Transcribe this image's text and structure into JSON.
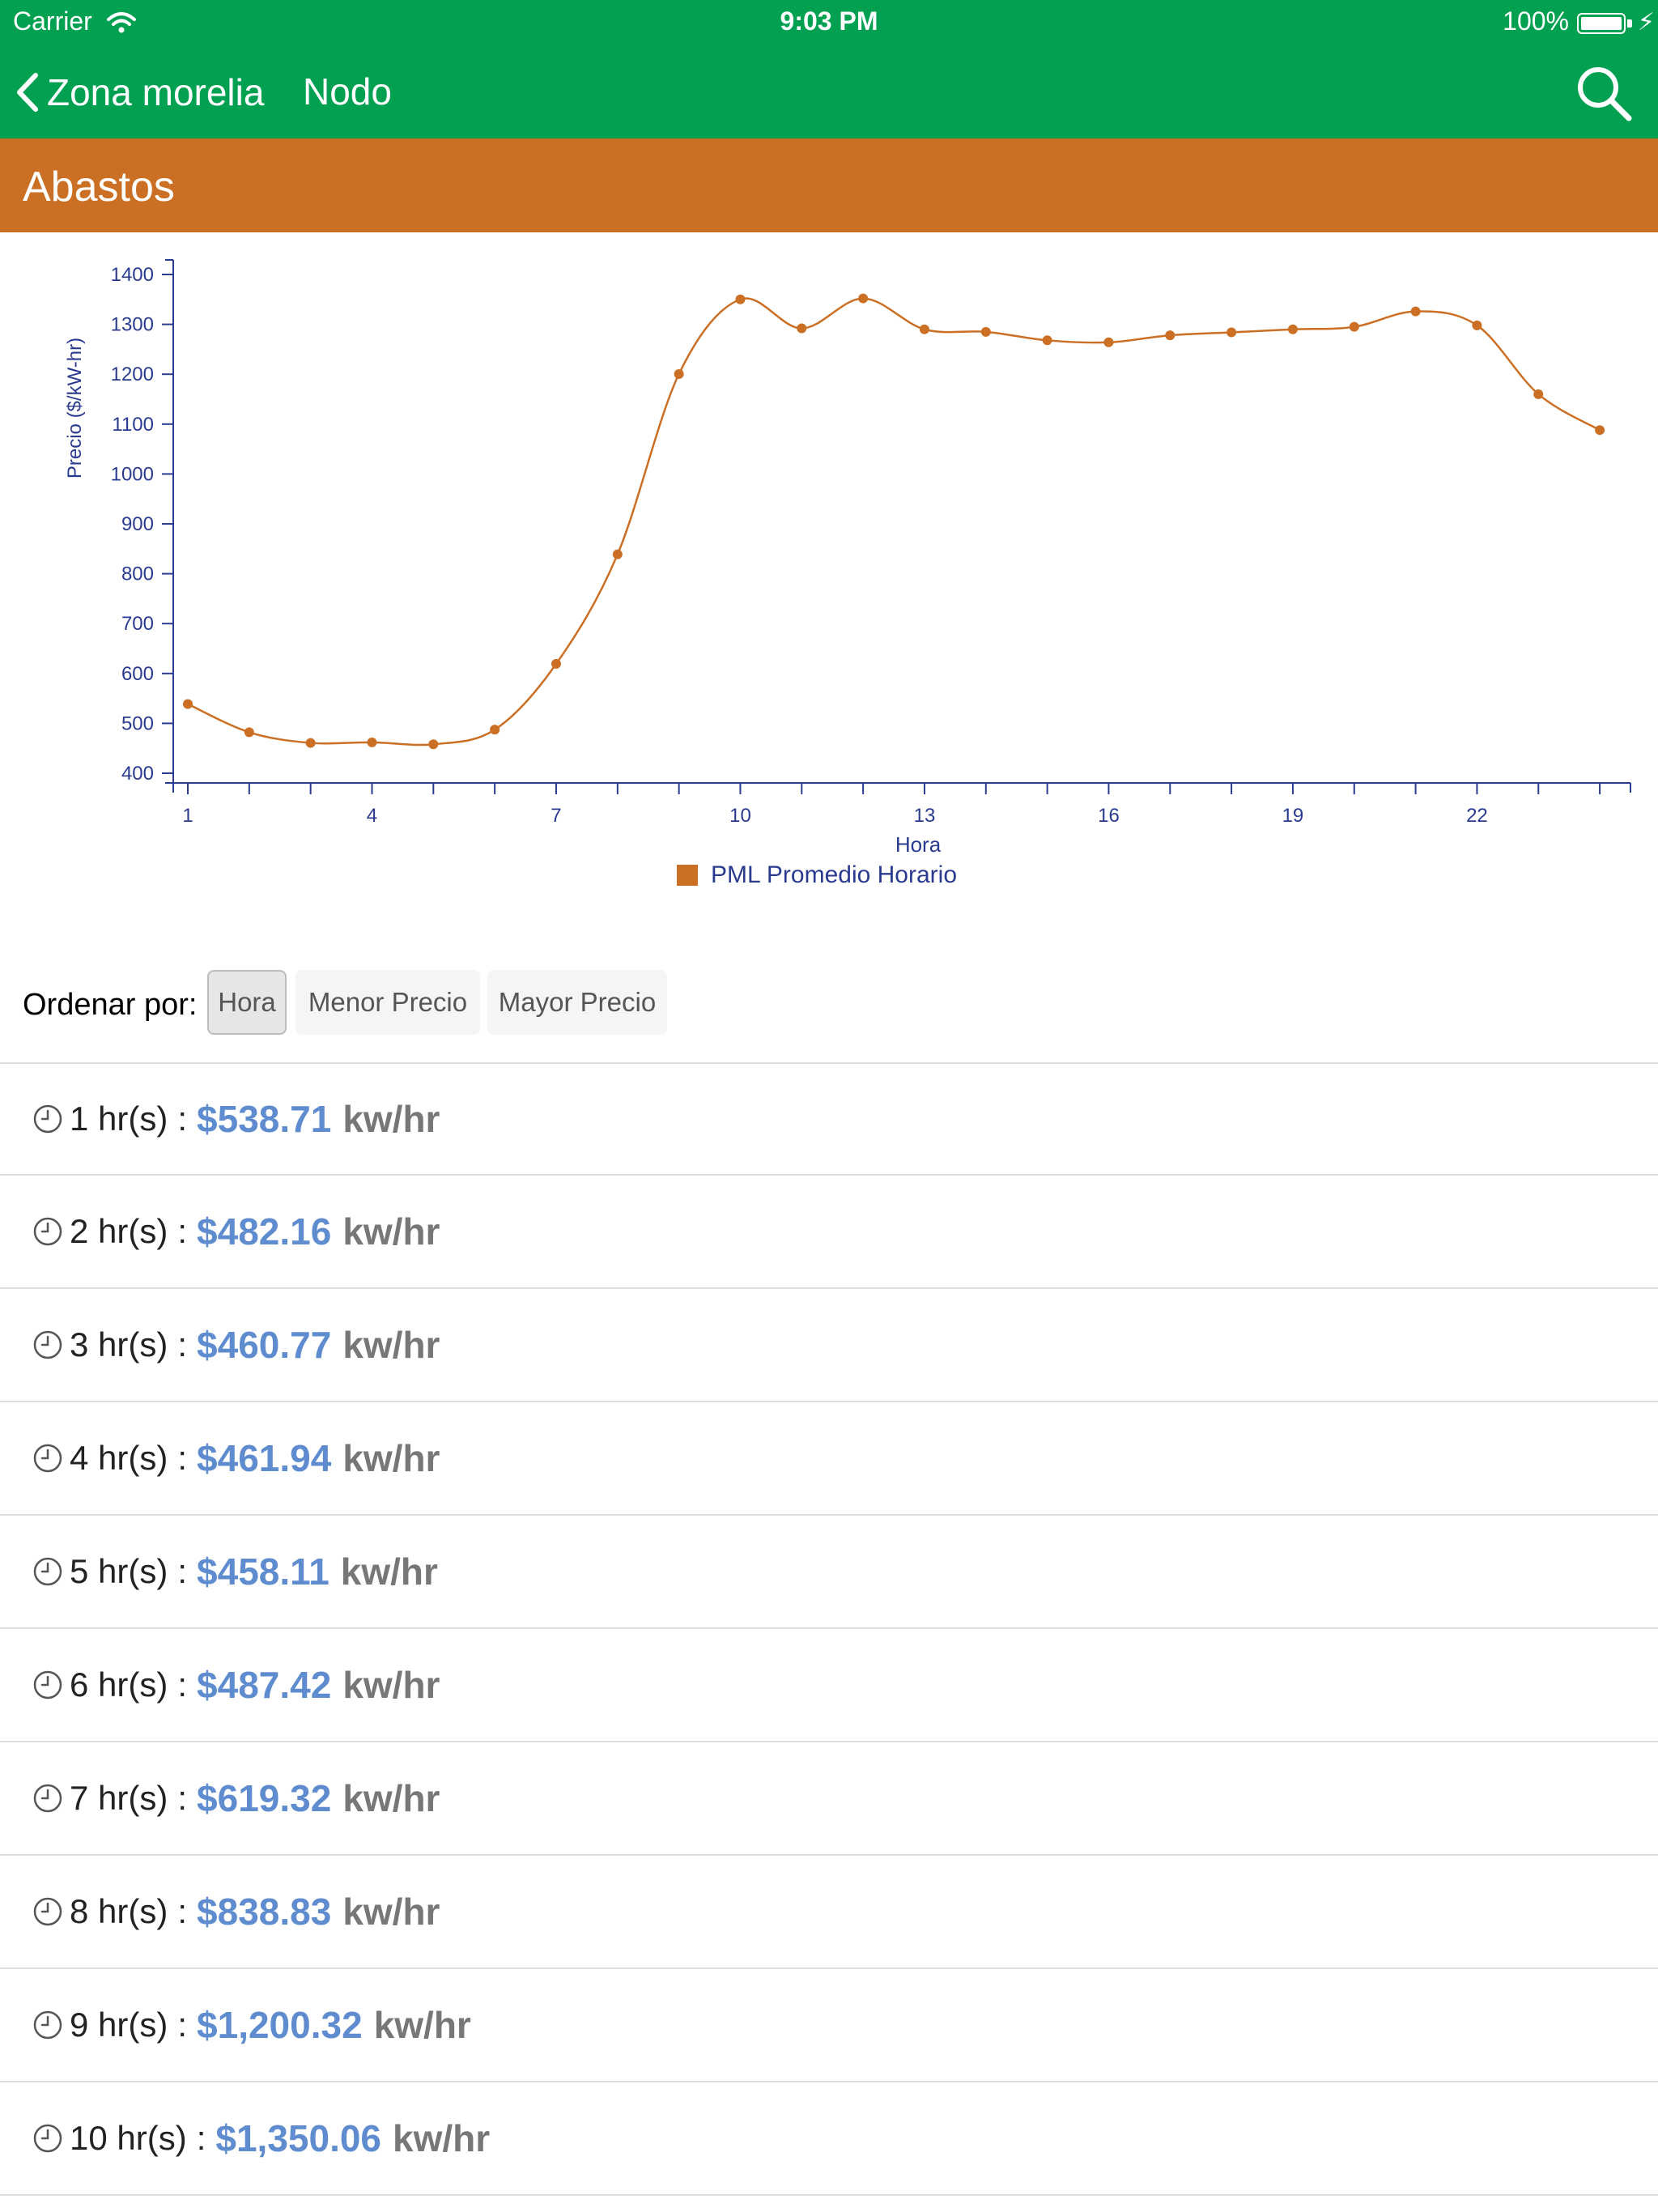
{
  "status_bar": {
    "carrier": "Carrier",
    "time": "9:03 PM",
    "battery": "100%"
  },
  "nav": {
    "back_label": "Zona morelia",
    "title": "Nodo"
  },
  "header": {
    "title": "Abastos"
  },
  "colors": {
    "green": "#02a152",
    "orange": "#cb6f24",
    "price_blue": "#5f8ccf",
    "axis_navy": "#2a3b8f"
  },
  "chart_data": {
    "type": "line",
    "title": "",
    "xlabel": "Hora",
    "ylabel": "Precio ($/kW-hr)",
    "xlim": [
      1,
      24
    ],
    "ylim": [
      400,
      1400
    ],
    "x_ticks": [
      1,
      4,
      7,
      10,
      13,
      16,
      19,
      22
    ],
    "y_ticks": [
      400,
      500,
      600,
      700,
      800,
      900,
      1000,
      1100,
      1200,
      1300,
      1400
    ],
    "legend_position": "bottom-center",
    "series": [
      {
        "name": "PML Promedio Horario",
        "color": "#cb6f24",
        "x": [
          1,
          2,
          3,
          4,
          5,
          6,
          7,
          8,
          9,
          10,
          11,
          12,
          13,
          14,
          15,
          16,
          17,
          18,
          19,
          20,
          21,
          22,
          23,
          24
        ],
        "y": [
          538.71,
          482.16,
          460.77,
          461.94,
          458.11,
          487.42,
          619.32,
          838.83,
          1200.32,
          1350.06,
          1292,
          1352,
          1290,
          1285,
          1268,
          1264,
          1278,
          1284,
          1290,
          1295,
          1326,
          1298,
          1160,
          1088
        ]
      }
    ]
  },
  "sort": {
    "label": "Ordenar por:",
    "options": [
      "Hora",
      "Menor Precio",
      "Mayor Precio"
    ],
    "selected": "Hora"
  },
  "list": {
    "unit": "kw/hr",
    "items": [
      {
        "hour": "1 hr(s)",
        "price": "$538.71"
      },
      {
        "hour": "2 hr(s)",
        "price": "$482.16"
      },
      {
        "hour": "3 hr(s)",
        "price": "$460.77"
      },
      {
        "hour": "4 hr(s)",
        "price": "$461.94"
      },
      {
        "hour": "5 hr(s)",
        "price": "$458.11"
      },
      {
        "hour": "6 hr(s)",
        "price": "$487.42"
      },
      {
        "hour": "7 hr(s)",
        "price": "$619.32"
      },
      {
        "hour": "8 hr(s)",
        "price": "$838.83"
      },
      {
        "hour": "9 hr(s)",
        "price": "$1,200.32"
      },
      {
        "hour": "10 hr(s)",
        "price": "$1,350.06"
      }
    ]
  }
}
